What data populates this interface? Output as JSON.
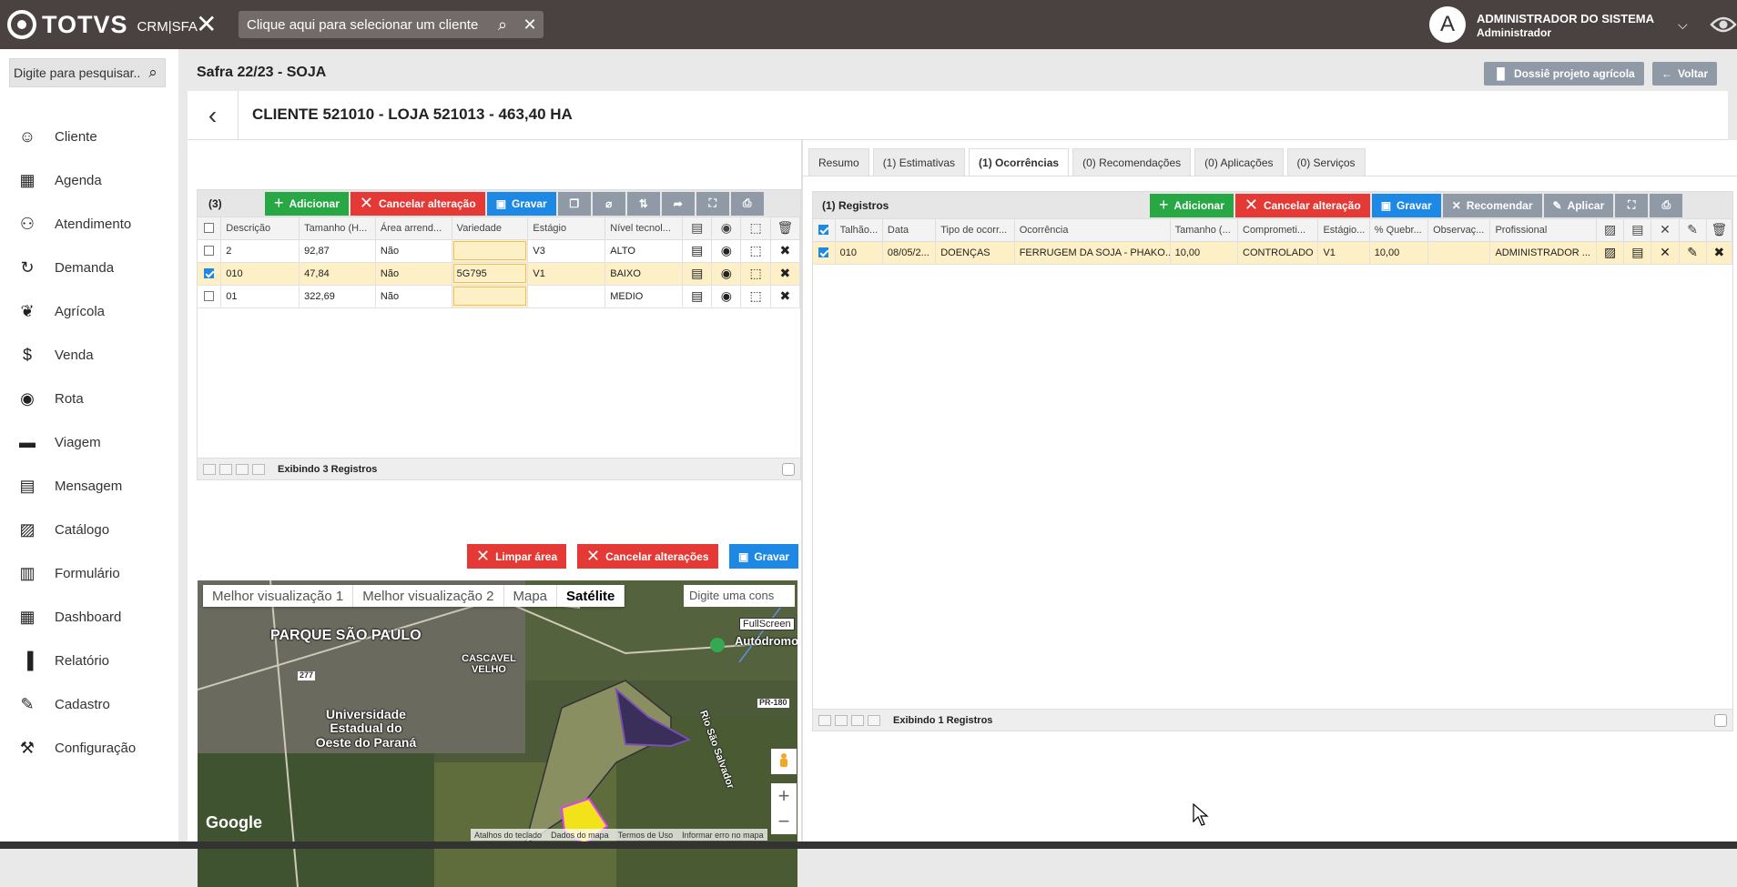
{
  "header": {
    "brand": "TOTVS",
    "brand_sub": "CRM|SFA",
    "client_placeholder": "Clique aqui para selecionar um cliente",
    "user_name": "ADMINISTRADOR DO SISTEMA",
    "user_role": "Administrador",
    "avatar_initial": "A"
  },
  "sidebar": {
    "search_placeholder": "Digite para pesquisar...",
    "items": [
      {
        "label": "Cliente",
        "icon": "person-icon"
      },
      {
        "label": "Agenda",
        "icon": "calendar-icon"
      },
      {
        "label": "Atendimento",
        "icon": "people-icon"
      },
      {
        "label": "Demanda",
        "icon": "dollar-cycle-icon"
      },
      {
        "label": "Agrícola",
        "icon": "leaf-icon"
      },
      {
        "label": "Venda",
        "icon": "dollar-icon"
      },
      {
        "label": "Rota",
        "icon": "location-pin-icon"
      },
      {
        "label": "Viagem",
        "icon": "car-icon"
      },
      {
        "label": "Mensagem",
        "icon": "message-icon"
      },
      {
        "label": "Catálogo",
        "icon": "image-icon"
      },
      {
        "label": "Formulário",
        "icon": "clipboard-icon"
      },
      {
        "label": "Dashboard",
        "icon": "dashboard-icon"
      },
      {
        "label": "Relatório",
        "icon": "bar-chart-icon"
      },
      {
        "label": "Cadastro",
        "icon": "pencil-icon"
      },
      {
        "label": "Configuração",
        "icon": "wrench-icon"
      }
    ]
  },
  "page": {
    "title": "Safra 22/23 - SOJA",
    "dossie_label": "Dossiê projeto agrícola",
    "voltar_label": "Voltar",
    "client_title": "CLIENTE 521010 - LOJA 521013 - 463,40 HA"
  },
  "left_grid": {
    "count": "(3)",
    "add_label": "Adicionar",
    "cancel_label": "Cancelar alteração",
    "save_label": "Gravar",
    "columns": [
      "Descrição",
      "Tamanho (H...",
      "Área arrend...",
      "Variedade",
      "Estágio",
      "Nível tecnol..."
    ],
    "rows": [
      {
        "descricao": "2",
        "tamanho": "92,87",
        "area": "Não",
        "variedade": "",
        "estagio": "V3",
        "nivel": "ALTO",
        "checked": false
      },
      {
        "descricao": "010",
        "tamanho": "47,84",
        "area": "Não",
        "variedade": "5G795",
        "estagio": "V1",
        "nivel": "BAIXO",
        "checked": true
      },
      {
        "descricao": "01",
        "tamanho": "322,69",
        "area": "Não",
        "variedade": "",
        "estagio": "",
        "nivel": "MEDIO",
        "checked": false
      }
    ],
    "pager_info": "Exibindo 3 Registros"
  },
  "map_toolbar": {
    "clear_label": "Limpar área",
    "cancel_label": "Cancelar alterações",
    "save_label": "Gravar"
  },
  "map": {
    "tabs": [
      "Melhor visualização 1",
      "Melhor visualização 2",
      "Mapa",
      "Satélite"
    ],
    "active_tab": "Satélite",
    "search_placeholder": "Digite uma cons",
    "fullscreen_label": "FullScreen",
    "labels": [
      "PARQUE SÃO PAULO",
      "CASCAVEL VELHO",
      "Universidade Estadual do Oeste do Paraná",
      "Autódromo Zilmar Beux de Cascavel",
      "Rio São Salvador",
      "277",
      "PR-180"
    ],
    "google": "Google",
    "attribution": [
      "Atalhos do teclado",
      "Dados do mapa",
      "Termos de Uso",
      "Informar erro no mapa"
    ]
  },
  "right": {
    "tabs": [
      "Resumo",
      "(1) Estimativas",
      "(1) Ocorrências",
      "(0) Recomendações",
      "(0) Aplicações",
      "(0) Serviços"
    ],
    "active_tab": "(1) Ocorrências",
    "count": "(1) Registros",
    "add_label": "Adicionar",
    "cancel_label": "Cancelar alteração",
    "save_label": "Gravar",
    "recommend_label": "Recomendar",
    "apply_label": "Aplicar",
    "columns": [
      "Talhão...",
      "Data",
      "Tipo de ocorr...",
      "Ocorrência",
      "Tamanho (...",
      "Comprometi...",
      "Estágio...",
      "% Quebr...",
      "Observaç...",
      "Profissional"
    ],
    "rows": [
      {
        "talhao": "010",
        "data": "08/05/2...",
        "tipo": "DOENÇAS",
        "ocorrencia": "FERRUGEM DA SOJA - PHAKO...",
        "tamanho": "10,00",
        "comprometimento": "CONTROLADO",
        "estagio": "V1",
        "quebra": "10,00",
        "observacao": "",
        "profissional": "ADMINISTRADOR ..."
      }
    ],
    "pager_info": "Exibindo 1 Registros"
  }
}
